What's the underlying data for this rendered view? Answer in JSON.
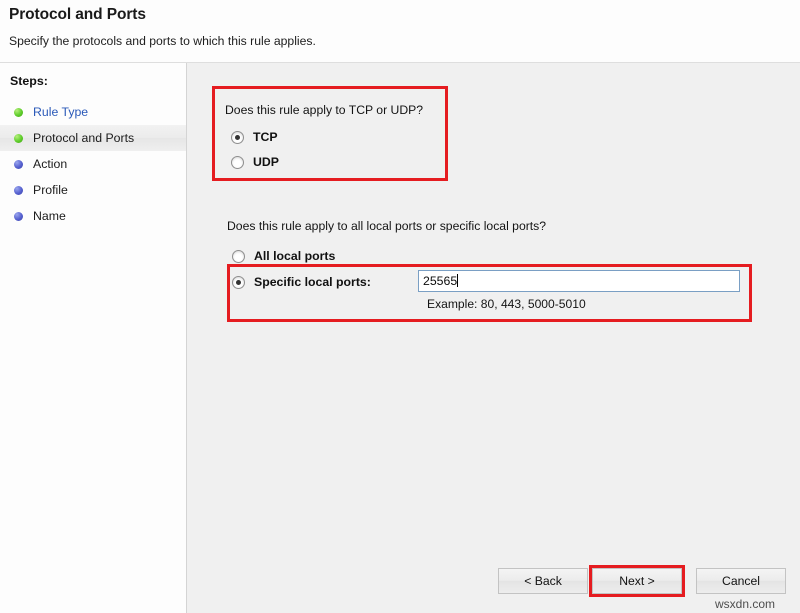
{
  "header": {
    "title": "Protocol and Ports",
    "subtitle": "Specify the protocols and ports to which this rule applies."
  },
  "sidebar": {
    "steps_label": "Steps:",
    "items": [
      {
        "label": "Rule Type",
        "state": "done",
        "is_link": true
      },
      {
        "label": "Protocol and Ports",
        "state": "done",
        "is_link": false
      },
      {
        "label": "Action",
        "state": "todo",
        "is_link": false
      },
      {
        "label": "Profile",
        "state": "todo",
        "is_link": false
      },
      {
        "label": "Name",
        "state": "todo",
        "is_link": false
      }
    ]
  },
  "main": {
    "protocol_question": "Does this rule apply to TCP or UDP?",
    "protocol_options": [
      {
        "label": "TCP",
        "checked": true
      },
      {
        "label": "UDP",
        "checked": false
      }
    ],
    "ports_question": "Does this rule apply to all local ports or specific local ports?",
    "port_options": [
      {
        "label": "All local ports",
        "checked": false
      },
      {
        "label": "Specific local ports:",
        "checked": true
      }
    ],
    "port_value": "25565",
    "port_placeholder": "",
    "port_example": "Example: 80, 443, 5000-5010"
  },
  "buttons": {
    "back": "< Back",
    "next": "Next >",
    "cancel": "Cancel"
  },
  "watermark": "wsxdn.com",
  "colors": {
    "annotation_red": "#e51c20",
    "link_blue": "#2a59b8",
    "step_done_green": "#62cf2e",
    "step_todo_blue": "#5560cf",
    "focus_underline": "#3c5fa8"
  }
}
